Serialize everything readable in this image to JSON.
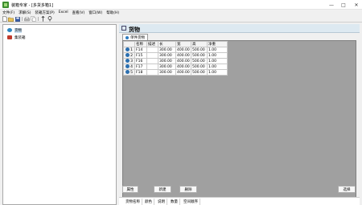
{
  "window": {
    "title": "装箱专家 - [多货多箱1]",
    "minimize": "—",
    "maximize": "□",
    "close": "✕"
  },
  "menu": [
    "文件(F)",
    "求解(S)",
    "装箱方案(P)",
    "Excel",
    "查看(V)",
    "窗口(W)",
    "帮助(H)"
  ],
  "toolbar": [
    "new-file-icon",
    "open-folder-icon",
    "save-icon",
    "print-icon",
    "copy-icon",
    "sort-icon",
    "help-icon"
  ],
  "sidebar": {
    "items": [
      {
        "label": "货物",
        "icon_color": "#2e86c1",
        "selected": true
      },
      {
        "label": "集装箱",
        "icon_color": "#c0392b",
        "selected": false
      }
    ]
  },
  "header": {
    "title": "货物"
  },
  "tab": {
    "label": "单件货物"
  },
  "grid": {
    "columns": [
      "",
      "名称",
      "描述",
      "长",
      "宽",
      "高",
      "净重"
    ],
    "rows": [
      {
        "index": "1",
        "name": "F14",
        "desc": "",
        "length": "300.00",
        "width": "400.00",
        "height": "500.00",
        "weight": "1.00"
      },
      {
        "index": "2",
        "name": "F15",
        "desc": "",
        "length": "300.00",
        "width": "400.00",
        "height": "500.00",
        "weight": "1.00"
      },
      {
        "index": "3",
        "name": "F16",
        "desc": "",
        "length": "300.00",
        "width": "400.00",
        "height": "500.00",
        "weight": "1.00"
      },
      {
        "index": "4",
        "name": "F17",
        "desc": "",
        "length": "300.00",
        "width": "400.00",
        "height": "500.00",
        "weight": "1.00"
      },
      {
        "index": "5",
        "name": "F18",
        "desc": "",
        "length": "300.00",
        "width": "400.00",
        "height": "500.00",
        "weight": "1.00"
      }
    ]
  },
  "buttons": {
    "properties": "属性",
    "new": "新建",
    "delete": "删除",
    "select": "选择"
  },
  "bottom_tabs": [
    "货物名称",
    "颜色",
    "说明",
    "数量",
    "空间顺序"
  ]
}
